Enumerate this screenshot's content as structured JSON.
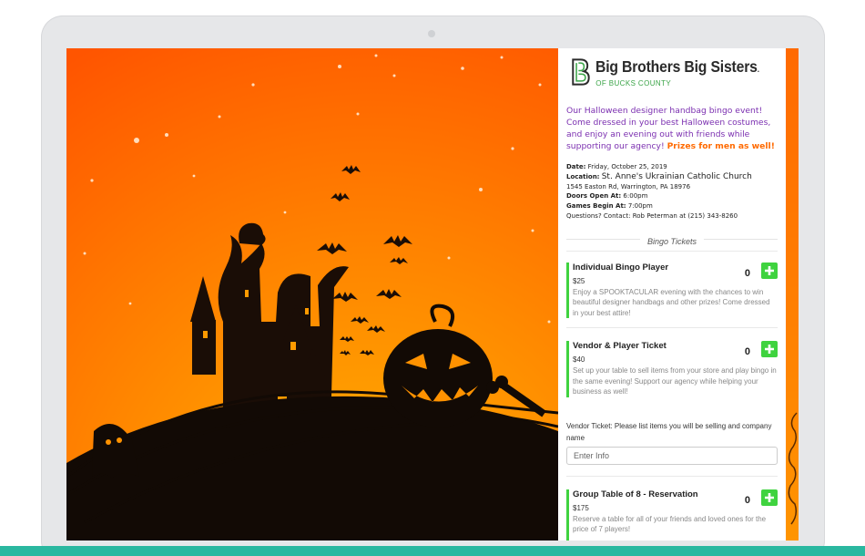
{
  "org": {
    "name": "Big Brothers Big Sisters",
    "trademark": ".",
    "subtitle": "OF BUCKS COUNTY",
    "logo_letter": "B"
  },
  "intro": {
    "text": "Our Halloween designer handbag bingo event! Come dressed in your best Halloween costumes, and enjoy an evening out with friends while supporting our agency!",
    "highlight": "Prizes for men as well!"
  },
  "details": {
    "date_label": "Date:",
    "date_value": "Friday, October 25, 2019",
    "location_label": "Location:",
    "location_value": "St. Anne's Ukrainian Catholic Church",
    "address": "1545 Easton Rd, Warrington, PA 18976",
    "doors_label": "Doors Open At:",
    "doors_value": "6:00pm",
    "games_label": "Games Begin At:",
    "games_value": "7:00pm",
    "questions": "Questions? Contact: Rob Peterman at (215) 343-8260"
  },
  "tickets_section": {
    "title": "Bingo Tickets",
    "items": [
      {
        "name": "Individual Bingo Player",
        "price": "$25",
        "description": "Enjoy a SPOOKTACULAR evening with the chances to win beautiful designer handbags and other prizes! Come dressed in your best attire!",
        "quantity": "0"
      },
      {
        "name": "Vendor & Player Ticket",
        "price": "$40",
        "description": "Set up your table to sell items from your store and play bingo in the same evening! Support our agency while helping your business as well!",
        "quantity": "0"
      },
      {
        "name": "Group Table of 8 - Reservation",
        "price": "$175",
        "description": "Reserve a table for all of your friends and loved ones for the price of 7 players!",
        "quantity": "0"
      }
    ]
  },
  "vendor_field": {
    "label": "Vendor Ticket: Please list items you will be selling and company name",
    "placeholder": "Enter Info",
    "value": ""
  },
  "colors": {
    "accent_green": "#3fd33f",
    "intro_purple": "#7b2fb0",
    "highlight_orange": "#ff6a00",
    "brand_green": "#3aa447",
    "teal_bar": "#2ab8a0"
  },
  "icons": {
    "plus": "plus-icon",
    "logo": "bbbs-logo-icon"
  }
}
